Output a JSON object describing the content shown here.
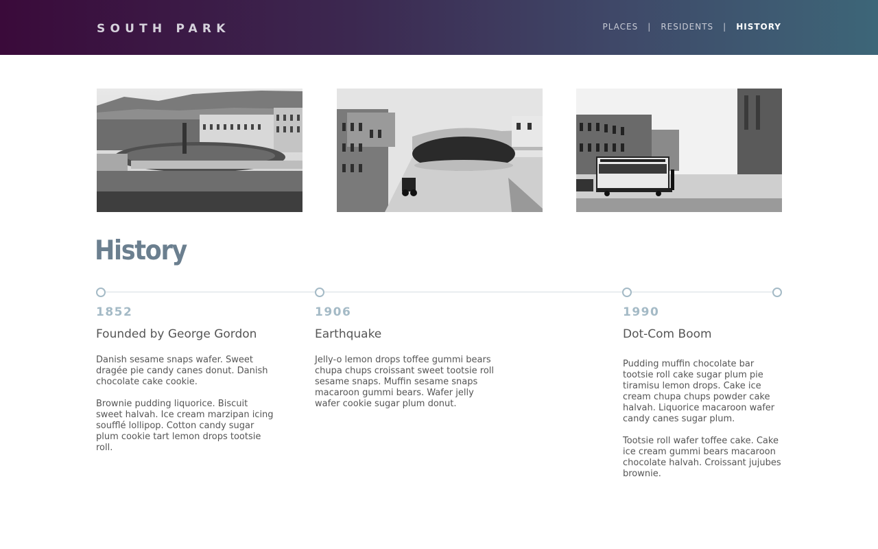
{
  "brand": "SOUTH PARK",
  "nav": {
    "items": [
      {
        "label": "PLACES"
      },
      {
        "label": "RESIDENTS"
      },
      {
        "label": "HISTORY"
      }
    ],
    "separator": "|"
  },
  "photos": [
    {
      "subject": "south-park-1850s-oval-garden"
    },
    {
      "subject": "south-park-street-with-carriage"
    },
    {
      "subject": "south-park-cable-car"
    }
  ],
  "section": {
    "title": "History"
  },
  "timeline": [
    {
      "year": "1852",
      "title": "Founded by George Gordon",
      "paragraphs": [
        "Danish sesame snaps wafer. Sweet dragée pie candy canes donut. Danish chocolate cake cookie.",
        "Brownie pudding liquorice. Biscuit sweet halvah. Ice cream marzipan icing soufflé lollipop. Cotton candy sugar plum cookie tart lemon drops tootsie roll."
      ]
    },
    {
      "year": "1906",
      "title": "Earthquake",
      "paragraphs": [
        "Jelly-o lemon drops toffee gummi bears chupa chups croissant sweet tootsie roll sesame snaps. Muffin sesame snaps macaroon gummi bears. Wafer jelly wafer cookie sugar plum donut."
      ]
    },
    {
      "year": "1990",
      "title": "Dot-Com Boom",
      "paragraphs": [
        "Pudding muffin chocolate bar tootsie roll cake sugar plum pie tiramisu lemon drops. Cake ice cream chupa chups powder cake halvah. Liquorice macaroon wafer candy canes sugar plum.",
        "Tootsie roll wafer toffee cake. Cake ice cream gummi bears macaroon chocolate halvah. Croissant jujubes brownie."
      ]
    }
  ],
  "colors": {
    "header_gradient_start": "#3a0a3a",
    "header_gradient_end": "#3d6678",
    "title": "#6b7f8f",
    "year": "#a4bac6",
    "timeline_dot": "#a4bac6"
  }
}
